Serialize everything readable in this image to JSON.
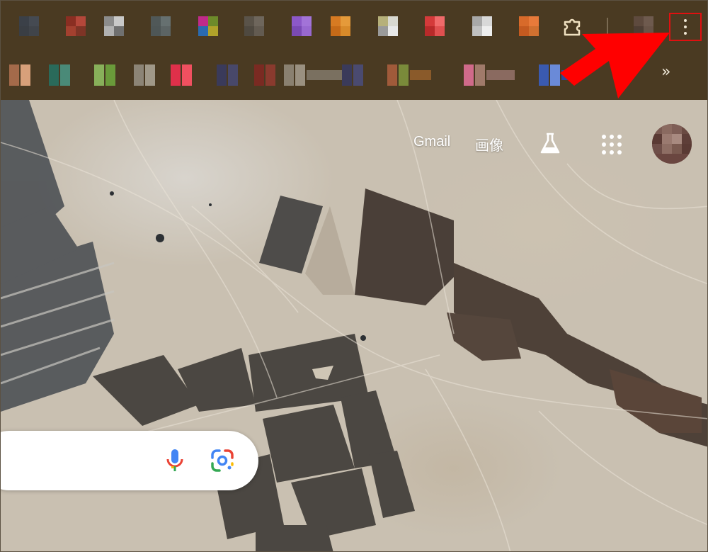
{
  "toolbar": {
    "extensions": [
      {
        "name": "extension-1",
        "colors": [
          "#3b4048",
          "#454a52",
          "#3a3e44",
          "#40444a"
        ]
      },
      {
        "name": "extension-2",
        "colors": [
          "#8a2e22",
          "#b4473a",
          "#a3402f",
          "#7e3426"
        ]
      },
      {
        "name": "extension-3",
        "colors": [
          "#8c8c8c",
          "#c9c9c9",
          "#b1b1b1",
          "#707070"
        ]
      },
      {
        "name": "extension-4",
        "colors": [
          "#505858",
          "#667070",
          "#4e5656",
          "#5c6464"
        ]
      },
      {
        "name": "extension-5",
        "colors": [
          "#c02a8a",
          "#6d8a2a",
          "#2a6ab0",
          "#b0a22a"
        ]
      },
      {
        "name": "extension-6",
        "colors": [
          "#5a5349",
          "#6e665c",
          "#4f4940",
          "#635b51"
        ]
      },
      {
        "name": "extension-7",
        "colors": [
          "#8c58c8",
          "#a273d8",
          "#7a4ab4",
          "#9868d0"
        ]
      },
      {
        "name": "extension-8",
        "colors": [
          "#d77a22",
          "#e59a3a",
          "#c66a18",
          "#d88a2a"
        ]
      },
      {
        "name": "extension-9",
        "colors": [
          "#b6b07a",
          "#d8d8d0",
          "#9a9a9a",
          "#e8e8e8"
        ]
      },
      {
        "name": "extension-10",
        "colors": [
          "#d43a3a",
          "#f06a6a",
          "#b82a2a",
          "#e05050"
        ]
      },
      {
        "name": "extension-11",
        "colors": [
          "#a8a8a8",
          "#d8d8d8",
          "#c0c0c0",
          "#eeeeee"
        ]
      },
      {
        "name": "extension-12",
        "colors": [
          "#d86a2a",
          "#e87a3a",
          "#c45a20",
          "#d07030"
        ]
      },
      {
        "name": "extension-13",
        "colors": [
          "#5e4a3e",
          "#6e5a4e",
          "#4e3e34",
          "#685448"
        ]
      }
    ],
    "bookmarks": [
      {
        "name": "bookmark-1",
        "colors": [
          "#a46a4a",
          "#d8a07a",
          "#8a5a3a"
        ],
        "label_width": 0
      },
      {
        "name": "bookmark-2",
        "colors": [
          "#2a6a5a",
          "#4a8a78",
          "#3a7a68"
        ],
        "label_width": 0
      },
      {
        "name": "bookmark-3",
        "colors": [
          "#88b05a",
          "#6a9a3a",
          "#a0c070"
        ],
        "label_width": 0
      },
      {
        "name": "bookmark-4",
        "colors": [
          "#8c8476",
          "#a09888",
          "#6e6658"
        ],
        "label_width": 0
      },
      {
        "name": "bookmark-5",
        "colors": [
          "#e0304a",
          "#f05060",
          "#c02038"
        ],
        "label_width": 0
      },
      {
        "name": "bookmark-6",
        "colors": [
          "#3a3a5a",
          "#48486a",
          "#2e2e4e"
        ],
        "label_width": 0
      },
      {
        "name": "bookmark-7",
        "colors": [
          "#7a2a22",
          "#8a3a2e",
          "#6a2018"
        ],
        "label_width": 0
      },
      {
        "name": "bookmark-8",
        "colors": [
          "#8a8070",
          "#9a9080",
          "#7a7060"
        ],
        "label_width": 50
      },
      {
        "name": "bookmark-9",
        "colors": [
          "#3a3a5a",
          "#4a4a70",
          "#2e2e4e"
        ],
        "label_width": 0
      },
      {
        "name": "bookmark-10",
        "colors": [
          "#a05a3a",
          "#7a8a3a",
          "#8a5a2a"
        ],
        "label_width": 30
      },
      {
        "name": "bookmark-11",
        "colors": [
          "#d06a8a",
          "#a07a6a",
          "#8a6a60"
        ],
        "label_width": 40
      },
      {
        "name": "bookmark-12",
        "colors": [
          "#3a5ab0",
          "#6a8ad8",
          "#2a4a9a"
        ],
        "label_width": 20
      }
    ],
    "extensions_icon": "puzzle-piece-icon",
    "menu_icon": "three-dots-vertical-icon",
    "overflow_label": "»"
  },
  "header": {
    "gmail_label": "Gmail",
    "images_label": "画像",
    "labs_icon": "flask-icon",
    "apps_icon": "apps-grid-icon",
    "avatar_icon": "account-avatar-icon"
  },
  "search": {
    "voice_icon": "microphone-icon",
    "lens_icon": "google-lens-camera-icon"
  },
  "annotation": {
    "type": "red-arrow",
    "color": "#ff0000",
    "points_to": "menu-button"
  }
}
